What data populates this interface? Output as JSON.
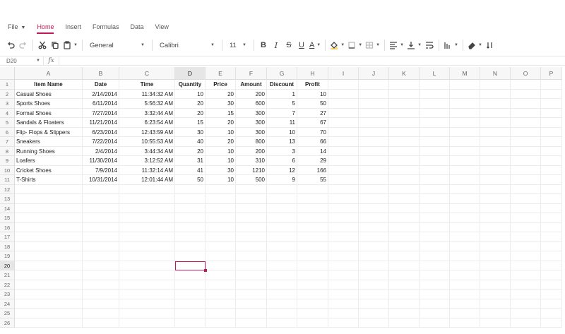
{
  "ribbon": {
    "file_label": "File",
    "tabs": [
      {
        "name": "home",
        "label": "Home",
        "active": true
      },
      {
        "name": "insert",
        "label": "Insert",
        "active": false
      },
      {
        "name": "formulas",
        "label": "Formulas",
        "active": false
      },
      {
        "name": "data",
        "label": "Data",
        "active": false
      },
      {
        "name": "view",
        "label": "View",
        "active": false
      }
    ]
  },
  "toolbar": {
    "number_format": "General",
    "font_name": "Calibri",
    "font_size": "11",
    "bold_label": "B",
    "italic_label": "I",
    "strike_label": "S",
    "underline_label": "U",
    "font_color_label": "A",
    "accent_color": "#c2185b"
  },
  "formula_bar": {
    "name_box": "D20",
    "fx_label": "fx",
    "value": ""
  },
  "sheet": {
    "columns": [
      "A",
      "B",
      "C",
      "D",
      "E",
      "F",
      "G",
      "H",
      "I",
      "J",
      "K",
      "L",
      "M",
      "N",
      "O",
      "P"
    ],
    "selected_column": "D",
    "selected_row": 20,
    "active_cell": "D20",
    "row_numbers": [
      1,
      2,
      3,
      4,
      5,
      6,
      7,
      8,
      9,
      10,
      11,
      12,
      13,
      14,
      15,
      16,
      17,
      18,
      19,
      20,
      21,
      22,
      23,
      24,
      25,
      26
    ],
    "headers": [
      "Item Name",
      "Date",
      "Time",
      "Quantity",
      "Price",
      "Amount",
      "Discount",
      "Profit"
    ],
    "rows": [
      [
        "Casual Shoes",
        "2/14/2014",
        "11:34:32 AM",
        "10",
        "20",
        "200",
        "1",
        "10"
      ],
      [
        "Sports Shoes",
        "6/11/2014",
        "5:56:32 AM",
        "20",
        "30",
        "600",
        "5",
        "50"
      ],
      [
        "Formal Shoes",
        "7/27/2014",
        "3:32:44 AM",
        "20",
        "15",
        "300",
        "7",
        "27"
      ],
      [
        "Sandals & Floaters",
        "11/21/2014",
        "6:23:54 AM",
        "15",
        "20",
        "300",
        "11",
        "67"
      ],
      [
        "Flip- Flops & Slippers",
        "6/23/2014",
        "12:43:59 AM",
        "30",
        "10",
        "300",
        "10",
        "70"
      ],
      [
        "Sneakers",
        "7/22/2014",
        "10:55:53 AM",
        "40",
        "20",
        "800",
        "13",
        "66"
      ],
      [
        "Running Shoes",
        "2/4/2014",
        "3:44:34 AM",
        "20",
        "10",
        "200",
        "3",
        "14"
      ],
      [
        "Loafers",
        "11/30/2014",
        "3:12:52 AM",
        "31",
        "10",
        "310",
        "6",
        "29"
      ],
      [
        "Cricket Shoes",
        "7/9/2014",
        "11:32:14 AM",
        "41",
        "30",
        "1210",
        "12",
        "166"
      ],
      [
        "T-Shirts",
        "10/31/2014",
        "12:01:44 AM",
        "50",
        "10",
        "500",
        "9",
        "55"
      ]
    ]
  }
}
